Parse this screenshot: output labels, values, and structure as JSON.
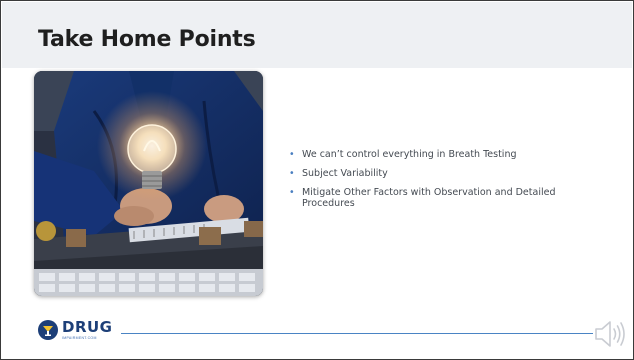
{
  "slide": {
    "title": "Take Home Points",
    "image": {
      "description_icon": "lightbulb-photo"
    },
    "bullets": [
      "We can’t control everything in Breath Testing",
      "Subject Variability",
      "Mitigate Other Factors with Observation and Detailed Procedures"
    ]
  },
  "footer": {
    "logo_word": "DRUG",
    "logo_subtext": "IMPAIRMENT.COM",
    "speaker_icon": "speaker-icon"
  },
  "colors": {
    "header_band": "#eef0f3",
    "title": "#1f1f1f",
    "bullet_text": "#444a52",
    "bullet_marker": "#4a7fc0",
    "footer_line": "#4a84c4",
    "logo": "#1d3f78"
  }
}
